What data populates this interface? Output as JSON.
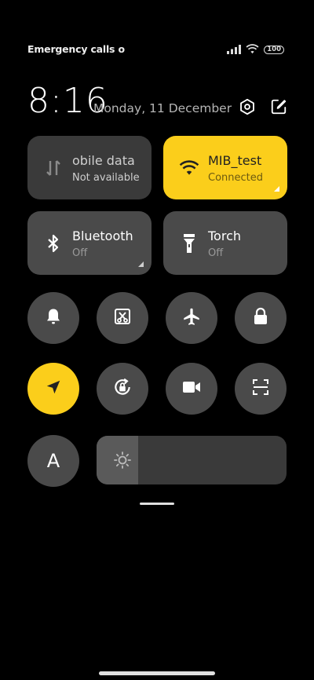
{
  "status": {
    "carrier_text": "Emergency calls o",
    "battery": "100",
    "signal_icon": "signal-bars-icon",
    "wifi_icon": "wifi-icon"
  },
  "header": {
    "time": "8:16",
    "date": "Monday, 11 December"
  },
  "tiles": {
    "mobile": {
      "label": "obile data",
      "status": "Not available",
      "icon": "mobile-data-icon"
    },
    "wifi": {
      "label": "MIB_test",
      "status": "Connected",
      "icon": "wifi-icon"
    },
    "bluetooth": {
      "label": "Bluetooth",
      "status": "Off",
      "icon": "bluetooth-icon"
    },
    "torch": {
      "label": "Torch",
      "status": "Off",
      "icon": "torch-icon"
    }
  },
  "toggles": [
    {
      "name": "bell-icon",
      "active": false
    },
    {
      "name": "screenshot-scissors-icon",
      "active": false
    },
    {
      "name": "airplane-icon",
      "active": false
    },
    {
      "name": "lock-icon",
      "active": false
    },
    {
      "name": "location-icon",
      "active": true
    },
    {
      "name": "rotation-lock-icon",
      "active": false
    },
    {
      "name": "video-camera-icon",
      "active": false
    },
    {
      "name": "scan-icon",
      "active": false
    }
  ],
  "font_toggle": {
    "label": "A"
  },
  "brightness": {
    "level": 0.22
  },
  "colors": {
    "accent": "#fbce1b",
    "tile": "#4a4a4a",
    "background": "#000000"
  }
}
